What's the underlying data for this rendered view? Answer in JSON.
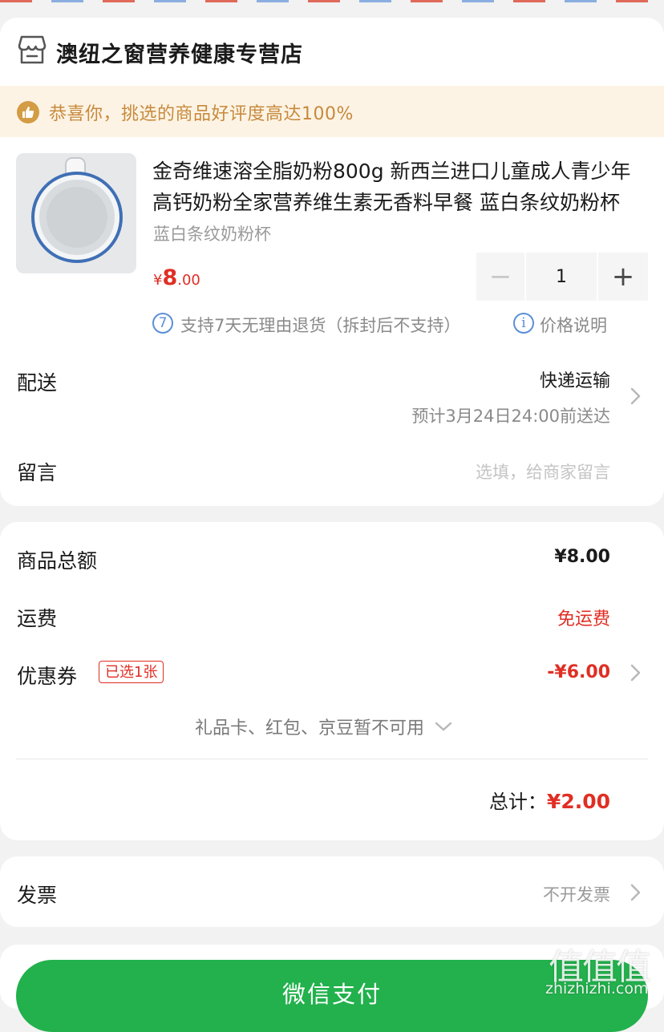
{
  "store": {
    "name": "澳纽之窗营养健康专营店",
    "icon": "store-icon"
  },
  "banner": {
    "text": "恭喜你，挑选的商品好评度高达100%",
    "icon": "thumbs-up-icon"
  },
  "product": {
    "title": "金奇维速溶全脂奶粉800g 新西兰进口儿童成人青少年高钙奶粉全家营养维生素无香料早餐 蓝白条纹奶粉杯",
    "spec": "蓝白条纹奶粉杯",
    "price_symbol": "¥",
    "price_int": "8",
    "price_dec": ".00",
    "quantity": "1",
    "minus_label": "−",
    "plus_label": "+",
    "return_badge": "7",
    "return_policy": "支持7天无理由退货（拆封后不支持）",
    "info_icon_label": "i",
    "price_note": "价格说明"
  },
  "delivery": {
    "label": "配送",
    "method": "快递运输",
    "eta": "预计3月24日24:00前送达"
  },
  "message": {
    "label": "留言",
    "placeholder": "选填，给商家留言"
  },
  "summary": {
    "goods_total_label": "商品总额",
    "goods_total_value": "¥8.00",
    "shipping_label": "运费",
    "shipping_value": "免运费",
    "coupon_label": "优惠券",
    "coupon_badge": "已选1张",
    "coupon_value": "-¥6.00",
    "unavailable_text": "礼品卡、红包、京豆暂不可用",
    "total_label": "总计：",
    "total_value": "¥2.00"
  },
  "invoice": {
    "label": "发票",
    "value": "不开发票"
  },
  "pay_button": {
    "label": "微信支付"
  },
  "watermark": {
    "logo": "值值值",
    "site": "zhizhizhi.com"
  },
  "colors": {
    "accent_red": "#e02e24",
    "pay_green": "#22b14c",
    "banner_gold": "#c68a3d"
  }
}
